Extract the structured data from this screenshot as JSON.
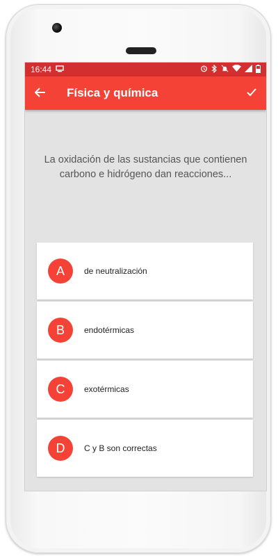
{
  "status": {
    "time": "16:44"
  },
  "appbar": {
    "title": "Física y química"
  },
  "question": {
    "text": "La oxidación de las sustancias que contienen carbono e hidrógeno dan reacciones..."
  },
  "options": [
    {
      "letter": "A",
      "text": "de neutralización"
    },
    {
      "letter": "B",
      "text": "endotérmicas"
    },
    {
      "letter": "C",
      "text": "exotérmicas"
    },
    {
      "letter": "D",
      "text": "C y B son correctas"
    }
  ],
  "colors": {
    "accent": "#f44336",
    "statusbar": "#d32f2f",
    "background": "#e3e3e3"
  },
  "icons": [
    "back-arrow-icon",
    "check-icon",
    "alarm-icon",
    "bluetooth-icon",
    "mute-icon",
    "wifi-icon",
    "signal-icon",
    "battery-icon",
    "screen-icon"
  ]
}
